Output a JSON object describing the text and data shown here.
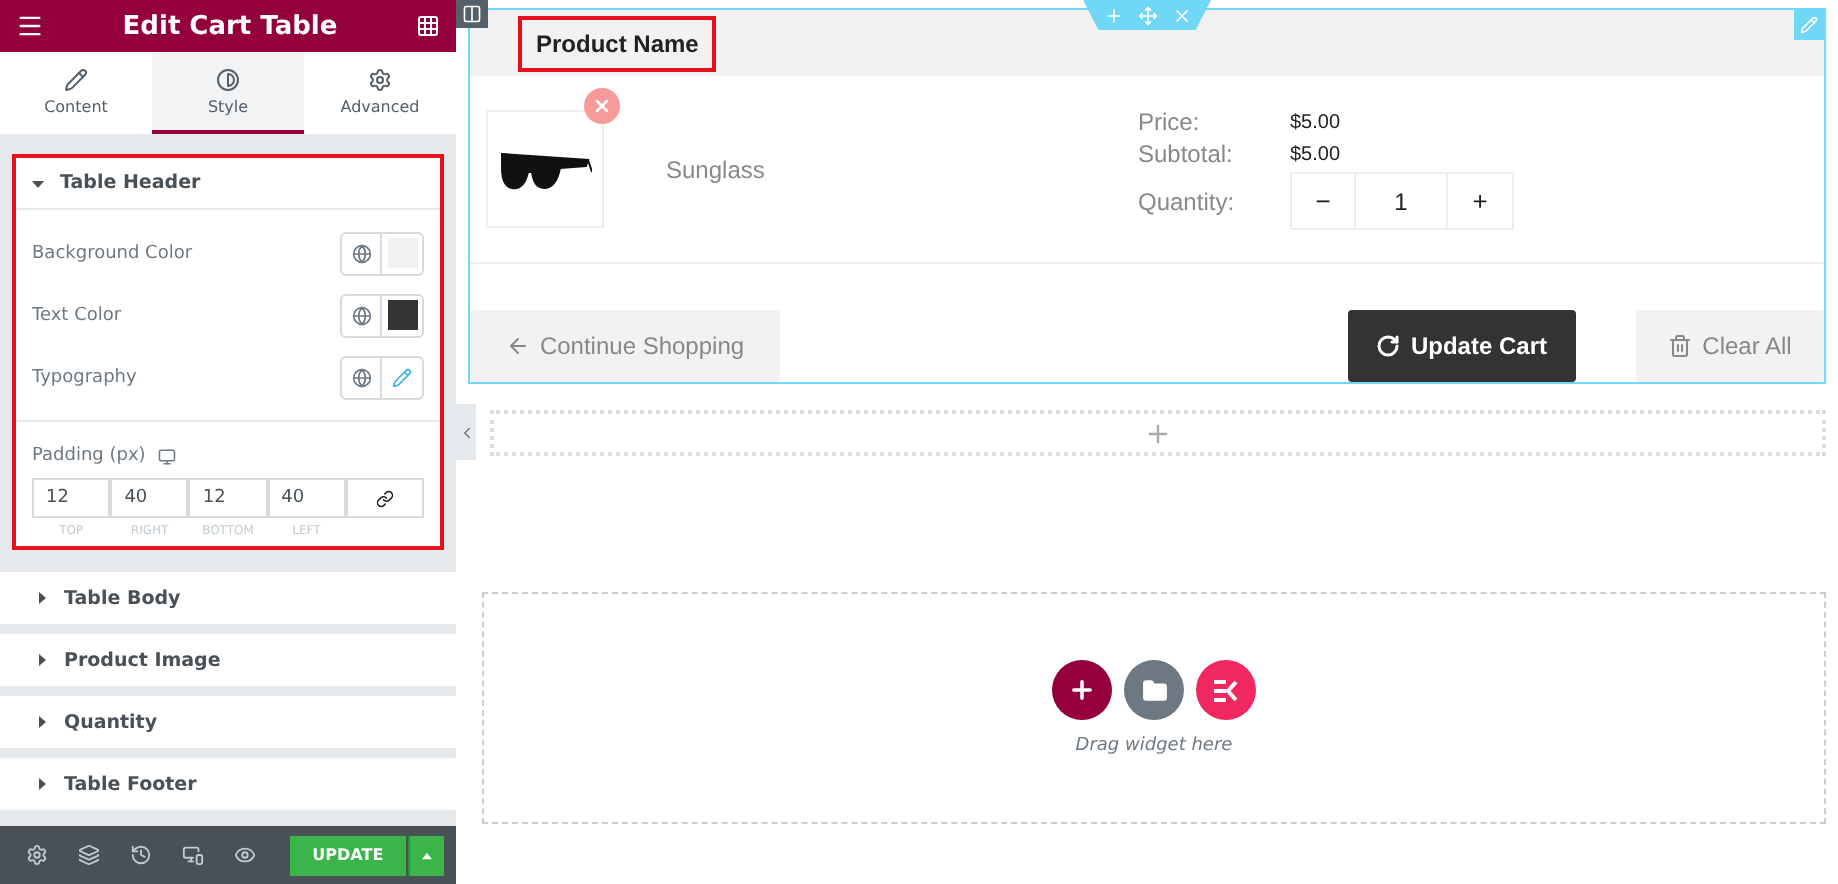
{
  "panel": {
    "title": "Edit Cart Table",
    "tabs": [
      {
        "label": "Content",
        "selected": false
      },
      {
        "label": "Style",
        "selected": true
      },
      {
        "label": "Advanced",
        "selected": false
      }
    ],
    "open_section": {
      "title": "Table Header",
      "expanded": true,
      "highlighted": true,
      "controls": [
        {
          "kind": "color",
          "label": "Background Color",
          "color": "#f1f1f1"
        },
        {
          "kind": "color",
          "label": "Text Color",
          "color": "#333333"
        },
        {
          "kind": "typography",
          "label": "Typography"
        }
      ],
      "padding": {
        "label": "Padding (px)",
        "fields": [
          {
            "value": "12",
            "label": "TOP"
          },
          {
            "value": "40",
            "label": "RIGHT"
          },
          {
            "value": "12",
            "label": "BOTTOM"
          },
          {
            "value": "40",
            "label": "LEFT"
          }
        ]
      }
    },
    "sections": [
      {
        "title": "Table Body",
        "expanded": false
      },
      {
        "title": "Product Image",
        "expanded": false
      },
      {
        "title": "Quantity",
        "expanded": false
      },
      {
        "title": "Table Footer",
        "expanded": false
      }
    ],
    "update_button": "UPDATE"
  },
  "cart": {
    "header": {
      "label": "Product Name",
      "highlighted": true
    },
    "item": {
      "name": "Sunglass",
      "price_label": "Price:",
      "price": "$5.00",
      "subtotal_label": "Subtotal:",
      "subtotal": "$5.00",
      "quantity_label": "Quantity:",
      "quantity": "1",
      "minus": "−",
      "plus": "+"
    },
    "buttons": [
      {
        "kind": "continue",
        "label": "Continue Shopping"
      },
      {
        "kind": "update",
        "label": "Update Cart"
      },
      {
        "kind": "clear",
        "label": "Clear All"
      }
    ]
  },
  "drop_area": {
    "hint": "Drag widget here"
  }
}
